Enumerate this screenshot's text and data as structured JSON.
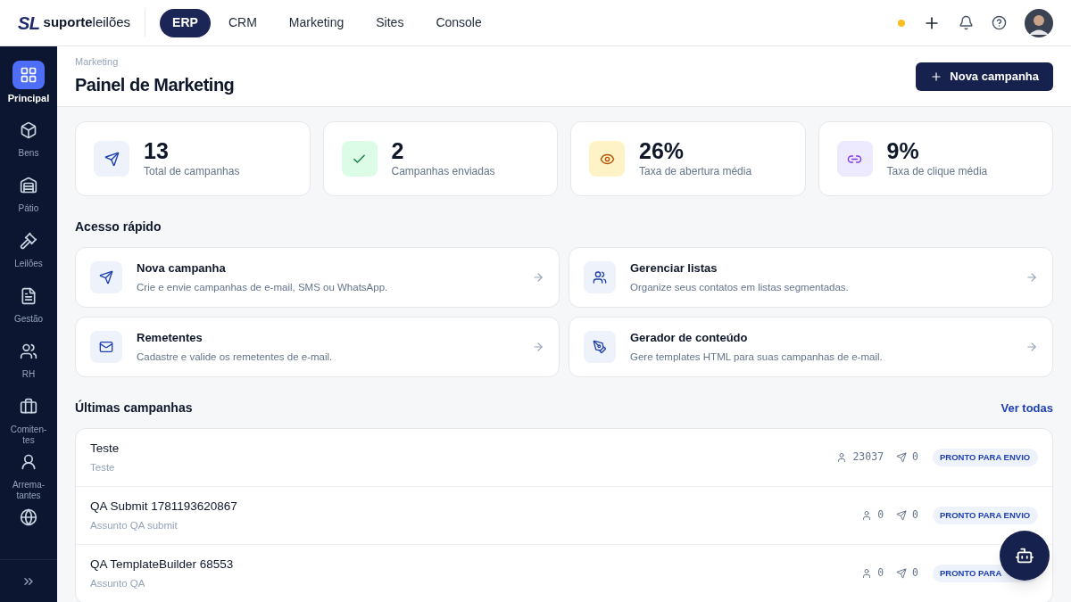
{
  "logo": {
    "mark": "SL",
    "word_bold": "suporte",
    "word_light": "leilões"
  },
  "top_nav": [
    {
      "label": "ERP",
      "selected": true
    },
    {
      "label": "CRM",
      "selected": false
    },
    {
      "label": "Marketing",
      "selected": false
    },
    {
      "label": "Sites",
      "selected": false
    },
    {
      "label": "Console",
      "selected": false
    }
  ],
  "sidebar": {
    "items": [
      {
        "label": "Principal",
        "selected": true
      },
      {
        "label": "Bens",
        "selected": false
      },
      {
        "label": "Pátio",
        "selected": false
      },
      {
        "label": "Leilões",
        "selected": false
      },
      {
        "label": "Gestão",
        "selected": false
      },
      {
        "label": "RH",
        "selected": false
      },
      {
        "label": "Comiten-tes",
        "selected": false
      },
      {
        "label": "Arrema-tantes",
        "selected": false
      },
      {
        "selected": false
      }
    ]
  },
  "page": {
    "breadcrumb": "Marketing",
    "title": "Painel de Marketing",
    "primary_button": "Nova campanha"
  },
  "stats": [
    {
      "value": "13",
      "label": "Total de campanhas"
    },
    {
      "value": "2",
      "label": "Campanhas enviadas"
    },
    {
      "value": "26%",
      "label": "Taxa de abertura média"
    },
    {
      "value": "9%",
      "label": "Taxa de clique média"
    }
  ],
  "quick_access": {
    "title": "Acesso rápido",
    "items": [
      {
        "title": "Nova campanha",
        "description": "Crie e envie campanhas de e-mail, SMS ou WhatsApp."
      },
      {
        "title": "Gerenciar listas",
        "description": "Organize seus contatos em listas segmentadas."
      },
      {
        "title": "Remetentes",
        "description": "Cadastre e valide os remetentes de e-mail."
      },
      {
        "title": "Gerador de conteúdo",
        "description": "Gere templates HTML para suas campanhas de e-mail."
      }
    ]
  },
  "recent": {
    "title": "Últimas campanhas",
    "link": "Ver todas",
    "rows": [
      {
        "name": "Teste",
        "subject": "Teste",
        "recipients": "23037",
        "sent": "0",
        "status": "PRONTO PARA ENVIO"
      },
      {
        "name": "QA Submit 1781193620867",
        "subject": "Assunto QA submit",
        "recipients": "0",
        "sent": "0",
        "status": "PRONTO PARA ENVIO"
      },
      {
        "name": "QA TemplateBuilder 68553",
        "subject": "Assunto QA",
        "recipients": "0",
        "sent": "0",
        "status": "PRONTO PARA"
      }
    ]
  }
}
